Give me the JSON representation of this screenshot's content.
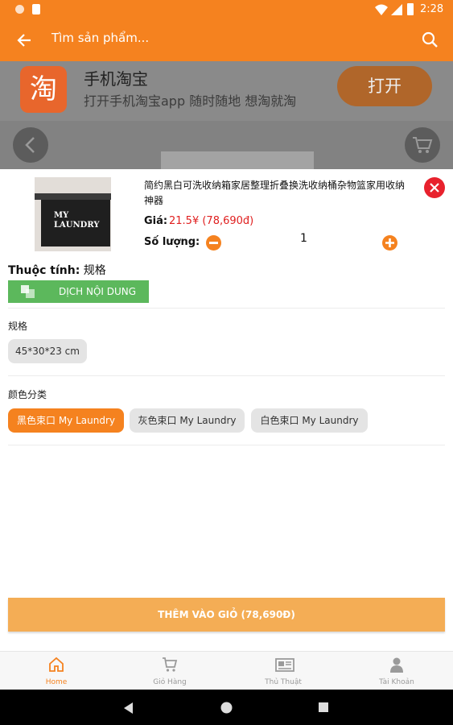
{
  "status_bar": {
    "time": "2:28"
  },
  "app_bar": {
    "search_placeholder": "Tìm sản phẩm..."
  },
  "background_page": {
    "app_name": "手机淘宝",
    "app_tagline": "打开手机淘宝app 随时随地 想淘就淘",
    "open_label": "打开",
    "logo_char": "淘"
  },
  "sheet": {
    "product_title": "简约黑白可洗收纳箱家居整理折叠换洗收纳桶杂物篮家用收纳神器",
    "image_text": "MY LAUNDRY",
    "price_label": "Giá:",
    "price_value": "21.5¥ (78,690đ)",
    "quantity_label": "Số lượng:",
    "quantity_value": "1",
    "attribute_label": "Thuộc tính:",
    "attribute_value": "规格",
    "translate_label": "DỊCH NỘI DUNG",
    "groups": [
      {
        "title": "规格",
        "options": [
          "45*30*23 cm"
        ],
        "selected": 0
      },
      {
        "title": "颜色分类",
        "options": [
          "黑色束口 My Laundry",
          "灰色束口 My Laundry",
          "白色束口 My Laundry"
        ],
        "selected": 0
      }
    ],
    "add_to_cart_label": "THÊM VÀO GIỎ (78,690Đ)"
  },
  "bottom_nav": {
    "tabs": [
      {
        "label": "Home",
        "icon": "home-icon",
        "active": true
      },
      {
        "label": "Giỏ Hàng",
        "icon": "cart-icon",
        "active": false
      },
      {
        "label": "Thủ Thuật",
        "icon": "newspaper-icon",
        "active": false
      },
      {
        "label": "Tài Khoản",
        "icon": "user-icon",
        "active": false
      }
    ]
  },
  "colors": {
    "primary": "#f5821f",
    "price": "#e02020",
    "translate": "#5cb85c",
    "close": "#e8212d"
  }
}
